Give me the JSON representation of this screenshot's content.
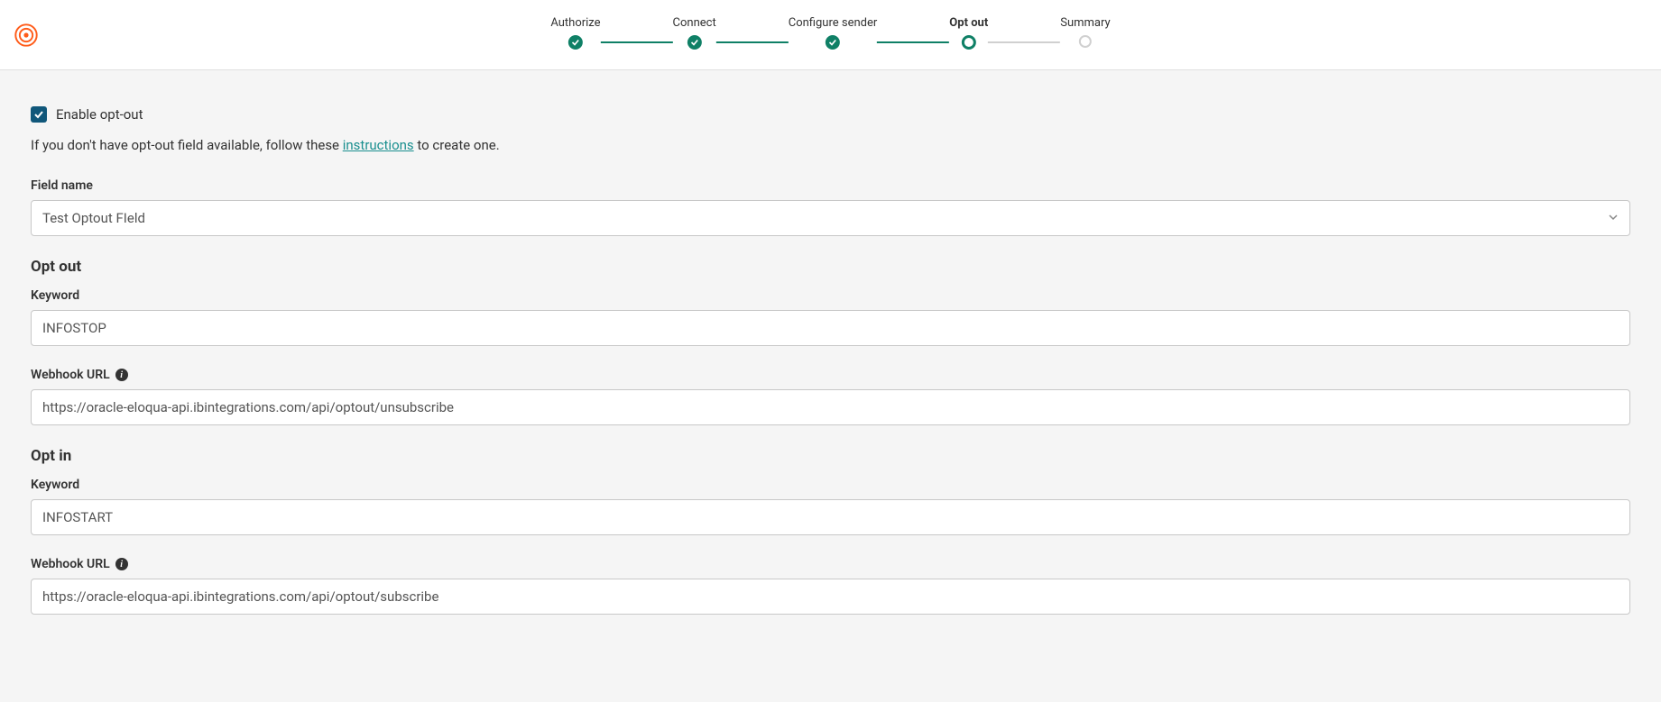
{
  "stepper": {
    "steps": [
      {
        "label": "Authorize",
        "state": "done"
      },
      {
        "label": "Connect",
        "state": "done"
      },
      {
        "label": "Configure sender",
        "state": "done"
      },
      {
        "label": "Opt out",
        "state": "current"
      },
      {
        "label": "Summary",
        "state": "pending"
      }
    ]
  },
  "enable_optout": {
    "checked": true,
    "label": "Enable opt-out"
  },
  "help_text": {
    "prefix": "If you don't have opt-out field available, follow these ",
    "link": "instructions",
    "suffix": " to create one."
  },
  "field_name": {
    "label": "Field name",
    "value": "Test Optout FIeld"
  },
  "opt_out": {
    "title": "Opt out",
    "keyword_label": "Keyword",
    "keyword_value": "INFOSTOP",
    "webhook_label": "Webhook URL",
    "webhook_value": "https://oracle-eloqua-api.ibintegrations.com/api/optout/unsubscribe"
  },
  "opt_in": {
    "title": "Opt in",
    "keyword_label": "Keyword",
    "keyword_value": "INFOSTART",
    "webhook_label": "Webhook URL",
    "webhook_value": "https://oracle-eloqua-api.ibintegrations.com/api/optout/subscribe"
  }
}
